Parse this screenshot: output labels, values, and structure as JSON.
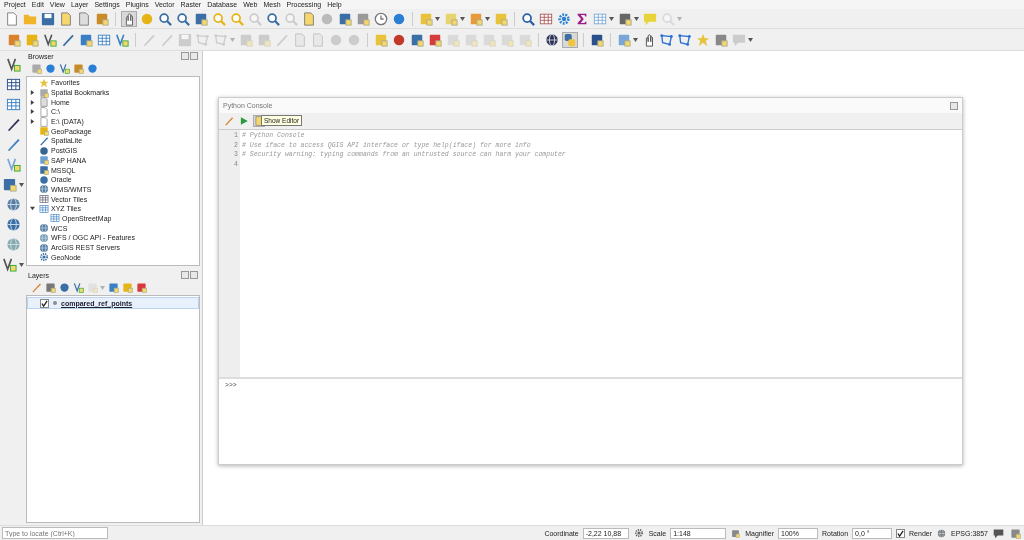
{
  "menu": [
    "Project",
    "Edit",
    "View",
    "Layer",
    "Settings",
    "Plugins",
    "Vector",
    "Raster",
    "Database",
    "Web",
    "Mesh",
    "Processing",
    "Help"
  ],
  "browser": {
    "title": "Browser",
    "items": [
      {
        "label": "Favorites"
      },
      {
        "label": "Spatial Bookmarks",
        "expanded": false
      },
      {
        "label": "Home",
        "expanded": false
      },
      {
        "label": "C:\\",
        "expanded": false
      },
      {
        "label": "E:\\ (DATA)",
        "expanded": false
      },
      {
        "label": "GeoPackage"
      },
      {
        "label": "SpatiaLite"
      },
      {
        "label": "PostGIS"
      },
      {
        "label": "SAP HANA"
      },
      {
        "label": "MSSQL"
      },
      {
        "label": "Oracle"
      },
      {
        "label": "WMS/WMTS"
      },
      {
        "label": "Vector Tiles"
      },
      {
        "label": "XYZ Tiles",
        "expanded": true,
        "children": [
          {
            "label": "OpenStreetMap"
          }
        ]
      },
      {
        "label": "WCS"
      },
      {
        "label": "WFS / OGC API - Features"
      },
      {
        "label": "ArcGIS REST Servers"
      },
      {
        "label": "GeoNode"
      }
    ]
  },
  "layers": {
    "title": "Layers",
    "items": [
      {
        "name": "compared_ref_points",
        "checked": true,
        "selected": true
      }
    ]
  },
  "console": {
    "title": "Python Console",
    "tooltip": "Show Editor",
    "lines": [
      {
        "number": "1",
        "text": "# Python Console"
      },
      {
        "number": "2",
        "text": "# Use iface to access QGIS API interface or type help(iface) for more info"
      },
      {
        "number": "3",
        "text": "# Security warning: typing commands from an untrusted source can harm your computer"
      },
      {
        "number": "4"
      }
    ],
    "prompt": ">>>"
  },
  "status_bar": {
    "locate_placeholder": "Type to locate (Ctrl+K)",
    "coordinate_label": "Coordinate",
    "coordinate": "-2,22 10,88",
    "scale_label": "Scale",
    "scale": "1:148",
    "magnifier_label": "Magnifier",
    "magnifier": "100%",
    "rotation_label": "Rotation",
    "rotation": "0,0 °",
    "render_label": "Render",
    "render": true,
    "crs": "EPSG:3857"
  }
}
